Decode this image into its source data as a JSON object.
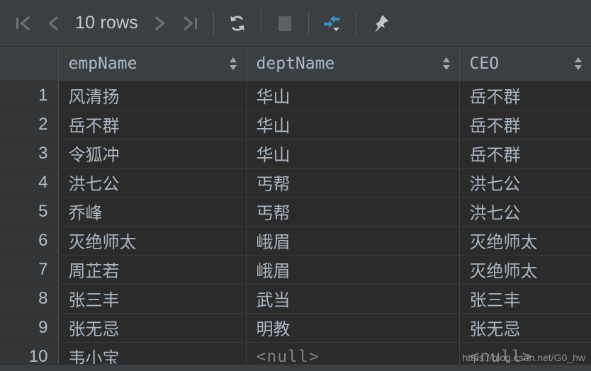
{
  "toolbar": {
    "first_page_label": "first-page",
    "prev_page_label": "previous-page",
    "row_count": "10 rows",
    "next_page_label": "next-page",
    "last_page_label": "last-page",
    "reload_label": "reload-data",
    "stop_label": "stop-loading",
    "transpose_label": "collapse-expand",
    "pin_label": "pin-tab",
    "accent_color": "#3592c4",
    "icon_color": "#6e7274",
    "text_color": "#c8c8c8"
  },
  "table": {
    "gutter_header": "",
    "columns": [
      {
        "label": "empName",
        "sort_icon": "sort-arrows-icon"
      },
      {
        "label": "deptName",
        "sort_icon": "sort-arrows-icon"
      },
      {
        "label": "CEO",
        "sort_icon": "sort-arrows-icon"
      }
    ],
    "null_text": "<null>",
    "rows": [
      {
        "n": "1",
        "empName": "风清扬",
        "deptName": "华山",
        "ceo": "岳不群"
      },
      {
        "n": "2",
        "empName": "岳不群",
        "deptName": "华山",
        "ceo": "岳不群"
      },
      {
        "n": "3",
        "empName": "令狐冲",
        "deptName": "华山",
        "ceo": "岳不群"
      },
      {
        "n": "4",
        "empName": "洪七公",
        "deptName": "丐帮",
        "ceo": "洪七公"
      },
      {
        "n": "5",
        "empName": "乔峰",
        "deptName": "丐帮",
        "ceo": "洪七公"
      },
      {
        "n": "6",
        "empName": "灭绝师太",
        "deptName": "峨眉",
        "ceo": "灭绝师太"
      },
      {
        "n": "7",
        "empName": "周芷若",
        "deptName": "峨眉",
        "ceo": "灭绝师太"
      },
      {
        "n": "8",
        "empName": "张三丰",
        "deptName": "武当",
        "ceo": "张三丰"
      },
      {
        "n": "9",
        "empName": "张无忌",
        "deptName": "明教",
        "ceo": "张无忌"
      },
      {
        "n": "10",
        "empName": "韦小宝",
        "deptName": "<null>",
        "ceo": "<null>"
      }
    ]
  },
  "watermark": {
    "text": "https://blog.csdn.net/G0_hw"
  }
}
